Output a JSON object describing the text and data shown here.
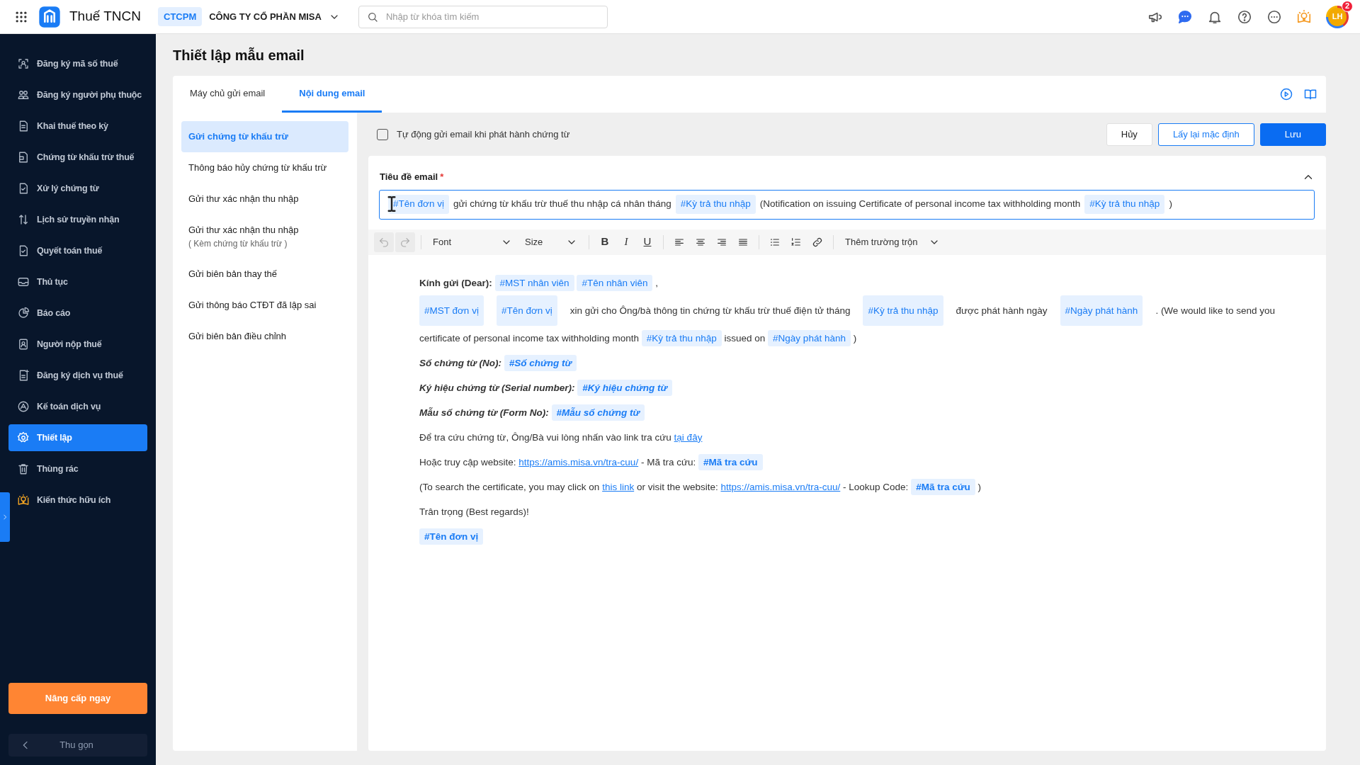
{
  "topbar": {
    "app_name": "Thuế TNCN",
    "company_tag": "CTCPM",
    "company_name": "CÔNG TY CỔ PHẦN MISA",
    "search": {
      "placeholder": "Nhập từ khóa tìm kiếm"
    },
    "avatar": {
      "initials": "LH",
      "badge": "2"
    }
  },
  "sidebar": {
    "items": [
      {
        "label": "Đăng ký mã số thuế",
        "selected": false
      },
      {
        "label": "Đăng ký người phụ thuộc",
        "selected": false
      },
      {
        "label": "Khai thuế theo kỳ",
        "selected": false
      },
      {
        "label": "Chứng từ khấu trừ thuế",
        "selected": false
      },
      {
        "label": "Xử lý chứng từ",
        "selected": false
      },
      {
        "label": "Lịch sử truyền nhận",
        "selected": false
      },
      {
        "label": "Quyết toán thuế",
        "selected": false
      },
      {
        "label": "Thủ tục",
        "selected": false
      },
      {
        "label": "Báo cáo",
        "selected": false
      },
      {
        "label": "Người nộp thuế",
        "selected": false
      },
      {
        "label": "Đăng ký dịch vụ thuế",
        "selected": false
      },
      {
        "label": "Kế toán dịch vụ",
        "selected": false
      },
      {
        "label": "Thiết lập",
        "selected": true
      },
      {
        "label": "Thùng rác",
        "selected": false
      },
      {
        "label": "Kiến thức hữu ích",
        "selected": false
      }
    ],
    "upgrade_button": "Nâng cấp ngay",
    "collapse_button": "Thu gọn"
  },
  "page_title": "Thiết lập mẫu email",
  "tabs": [
    {
      "label": "Máy chủ gửi email",
      "selected": false
    },
    {
      "label": "Nội dung email",
      "selected": true
    }
  ],
  "templates": [
    {
      "label": "Gửi chứng từ khấu trừ",
      "selected": true
    },
    {
      "label": "Thông báo hủy chứng từ khấu trừ",
      "selected": false
    },
    {
      "label": "Gửi thư xác nhận thu nhập",
      "selected": false
    },
    {
      "label": "Gửi thư xác nhận thu nhập",
      "sublabel": "( Kèm chứng từ khấu trừ )",
      "selected": false
    },
    {
      "label": "Gửi biên bản thay thế",
      "selected": false
    },
    {
      "label": "Gửi thông báo CTĐT đã lập sai",
      "selected": false
    },
    {
      "label": "Gửi biên bản điều chỉnh",
      "selected": false
    }
  ],
  "auto_send": {
    "label": "Tự động gửi email khi phát hành chứng từ",
    "checked": false
  },
  "buttons": [
    {
      "label": "Hủy",
      "kind": "secondary"
    },
    {
      "label": "Lấy lại mặc định",
      "kind": "outline"
    },
    {
      "label": "Lưu",
      "kind": "primary"
    }
  ],
  "subject": {
    "label": "Tiêu đề email",
    "required_mark": "*",
    "segments": [
      {
        "kind": "tag",
        "text": "#Tên đơn vị"
      },
      {
        "kind": "text",
        "text": "gửi chứng từ khấu trừ thuế thu nhập cá nhân tháng"
      },
      {
        "kind": "tag",
        "text": "#Kỳ trả thu nhập"
      },
      {
        "kind": "text",
        "text": "(Notification on issuing Certificate of personal income tax withholding month"
      },
      {
        "kind": "tag",
        "text": "#Kỳ trả thu nhập"
      },
      {
        "kind": "text",
        "text": ")"
      }
    ]
  },
  "toolbar": {
    "undo_disabled": true,
    "redo_disabled": true,
    "font": "Font",
    "size": "Size",
    "format_buttons": [
      "B",
      "I",
      "U"
    ],
    "merge_fields": "Thêm trường trộn"
  },
  "body_lines": [
    {
      "segments": [
        {
          "kind": "bold_text",
          "text": "Kính gửi (Dear):"
        },
        {
          "kind": "tag",
          "text": "#MST nhân viên"
        },
        {
          "kind": "tag",
          "text": "#Tên nhân viên"
        },
        {
          "kind": "text",
          "text": ","
        }
      ]
    },
    {
      "segments": [
        {
          "kind": "tag",
          "text": "#MST đơn vị"
        },
        {
          "kind": "tag",
          "text": "#Tên đơn vị"
        },
        {
          "kind": "text",
          "text": "xin gửi cho Ông/bà thông tin chứng từ khấu trừ thuế điện tử tháng"
        },
        {
          "kind": "tag",
          "text": "#Kỳ trả thu nhập"
        },
        {
          "kind": "text",
          "text": "được phát hành ngày"
        },
        {
          "kind": "tag",
          "text": "#Ngày phát hành"
        },
        {
          "kind": "text",
          "text": ". (We would like to send you"
        }
      ]
    },
    {
      "segments": [
        {
          "kind": "text",
          "text": "certificate of personal income tax withholding month"
        },
        {
          "kind": "tag",
          "text": "#Kỳ trả thu nhập"
        },
        {
          "kind": "text",
          "text": "issued on"
        },
        {
          "kind": "tag",
          "text": "#Ngày phát hành"
        },
        {
          "kind": "text",
          "text": ")"
        }
      ]
    },
    {
      "segments": [
        {
          "kind": "bold_italic_text",
          "text": "Số chứng từ (No):"
        },
        {
          "kind": "bold_italic_tag",
          "text": "#Số chứng từ"
        }
      ]
    },
    {
      "segments": [
        {
          "kind": "bold_italic_text",
          "text": "Ký hiệu chứng từ (Serial number):"
        },
        {
          "kind": "bold_italic_tag",
          "text": "#Ký hiệu chứng từ"
        }
      ]
    },
    {
      "segments": [
        {
          "kind": "bold_italic_text",
          "text": "Mẫu số chứng từ (Form No):"
        },
        {
          "kind": "bold_italic_tag",
          "text": "#Mẫu số chứng từ"
        }
      ]
    },
    {
      "segments": [
        {
          "kind": "text",
          "text": "Để tra cứu chứng từ, Ông/Bà vui lòng nhấn vào link tra cứu"
        },
        {
          "kind": "link",
          "text": "tại đây"
        }
      ]
    },
    {
      "segments": [
        {
          "kind": "text",
          "text": "Hoặc truy cập website:"
        },
        {
          "kind": "link",
          "text": "https://amis.misa.vn/tra-cuu/"
        },
        {
          "kind": "text",
          "text": "- Mã tra cứu:"
        },
        {
          "kind": "bold_tag",
          "text": "#Mã tra cứu"
        }
      ]
    },
    {
      "segments": [
        {
          "kind": "text",
          "text": "(To search the certificate, you may click on"
        },
        {
          "kind": "link",
          "text": "this link"
        },
        {
          "kind": "text",
          "text": "or visit the website:"
        },
        {
          "kind": "link",
          "text": "https://amis.misa.vn/tra-cuu/"
        },
        {
          "kind": "text",
          "text": "- Lookup Code:"
        },
        {
          "kind": "bold_tag",
          "text": "#Mã tra cứu"
        },
        {
          "kind": "text",
          "text": ")"
        }
      ]
    },
    {
      "segments": [
        {
          "kind": "text",
          "text": "Trân trọng (Best regards)!"
        }
      ]
    },
    {
      "segments": [
        {
          "kind": "bold_tag",
          "text": "#Tên đơn vị"
        }
      ]
    }
  ]
}
